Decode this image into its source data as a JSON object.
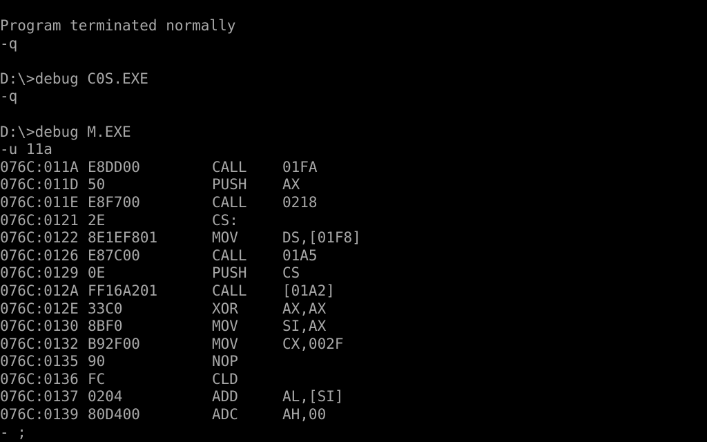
{
  "terminal": {
    "pre_lines": [
      "Program terminated normally",
      "-q",
      "",
      "D:\\>debug C0S.EXE",
      "-q",
      "",
      "D:\\>debug M.EXE",
      "-u 11a"
    ],
    "disassembly": [
      {
        "addr": "076C:011A",
        "bytes": "E8DD00",
        "mnemonic": "CALL",
        "operands": "01FA"
      },
      {
        "addr": "076C:011D",
        "bytes": "50",
        "mnemonic": "PUSH",
        "operands": "AX"
      },
      {
        "addr": "076C:011E",
        "bytes": "E8F700",
        "mnemonic": "CALL",
        "operands": "0218"
      },
      {
        "addr": "076C:0121",
        "bytes": "2E",
        "mnemonic": "CS:",
        "operands": ""
      },
      {
        "addr": "076C:0122",
        "bytes": "8E1EF801",
        "mnemonic": "MOV",
        "operands": "DS,[01F8]"
      },
      {
        "addr": "076C:0126",
        "bytes": "E87C00",
        "mnemonic": "CALL",
        "operands": "01A5"
      },
      {
        "addr": "076C:0129",
        "bytes": "0E",
        "mnemonic": "PUSH",
        "operands": "CS"
      },
      {
        "addr": "076C:012A",
        "bytes": "FF16A201",
        "mnemonic": "CALL",
        "operands": "[01A2]"
      },
      {
        "addr": "076C:012E",
        "bytes": "33C0",
        "mnemonic": "XOR",
        "operands": "AX,AX"
      },
      {
        "addr": "076C:0130",
        "bytes": "8BF0",
        "mnemonic": "MOV",
        "operands": "SI,AX"
      },
      {
        "addr": "076C:0132",
        "bytes": "B92F00",
        "mnemonic": "MOV",
        "operands": "CX,002F"
      },
      {
        "addr": "076C:0135",
        "bytes": "90",
        "mnemonic": "NOP",
        "operands": ""
      },
      {
        "addr": "076C:0136",
        "bytes": "FC",
        "mnemonic": "CLD",
        "operands": ""
      },
      {
        "addr": "076C:0137",
        "bytes": "0204",
        "mnemonic": "ADD",
        "operands": "AL,[SI]"
      },
      {
        "addr": "076C:0139",
        "bytes": "80D400",
        "mnemonic": "ADC",
        "operands": "AH,00"
      }
    ],
    "prompt_line": "- ;",
    "colors": {
      "background": "#000000",
      "text": "#a8a8a8"
    }
  }
}
